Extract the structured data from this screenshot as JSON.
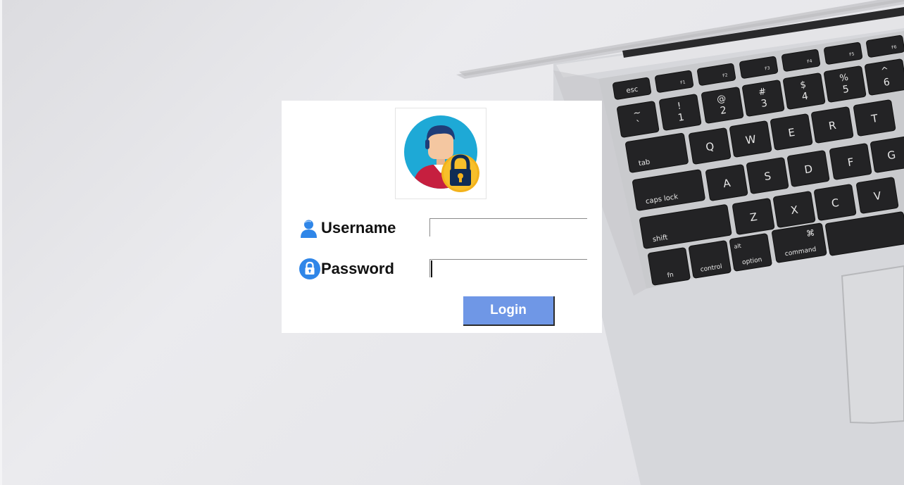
{
  "background": {
    "illustration": "laptop-keyboard-photo"
  },
  "laptop": {
    "keys_row_fn": [
      "esc",
      "F1",
      "F2",
      "F3",
      "F4",
      "F5",
      "F6"
    ],
    "keys_row_num": [
      {
        "top": "~",
        "bottom": "`"
      },
      {
        "top": "!",
        "bottom": "1"
      },
      {
        "top": "@",
        "bottom": "2"
      },
      {
        "top": "#",
        "bottom": "3"
      },
      {
        "top": "$",
        "bottom": "4"
      },
      {
        "top": "%",
        "bottom": "5"
      },
      {
        "top": "^",
        "bottom": "6"
      }
    ],
    "keys_row_q": [
      "tab",
      "Q",
      "W",
      "E",
      "R",
      "T"
    ],
    "keys_row_a": [
      "caps lock",
      "A",
      "S",
      "D",
      "F",
      "G"
    ],
    "keys_row_z": [
      "shift",
      "Z",
      "X",
      "C",
      "V"
    ],
    "keys_row_bottom": [
      "fn",
      "control",
      "option",
      "command"
    ],
    "option_top": "alt",
    "command_symbol": "⌘"
  },
  "login": {
    "avatar_icon": "user-lock-icon",
    "username_icon": "user-icon",
    "password_icon": "lock-icon",
    "username_label": "Username",
    "password_label": "Password",
    "username_value": "",
    "password_value": "",
    "login_button": "Login"
  },
  "colors": {
    "button": "#6f97e6",
    "icon_blue": "#2f86e8",
    "avatar_bg": "#1ea9d6",
    "lock_gold": "#f3b21b"
  }
}
